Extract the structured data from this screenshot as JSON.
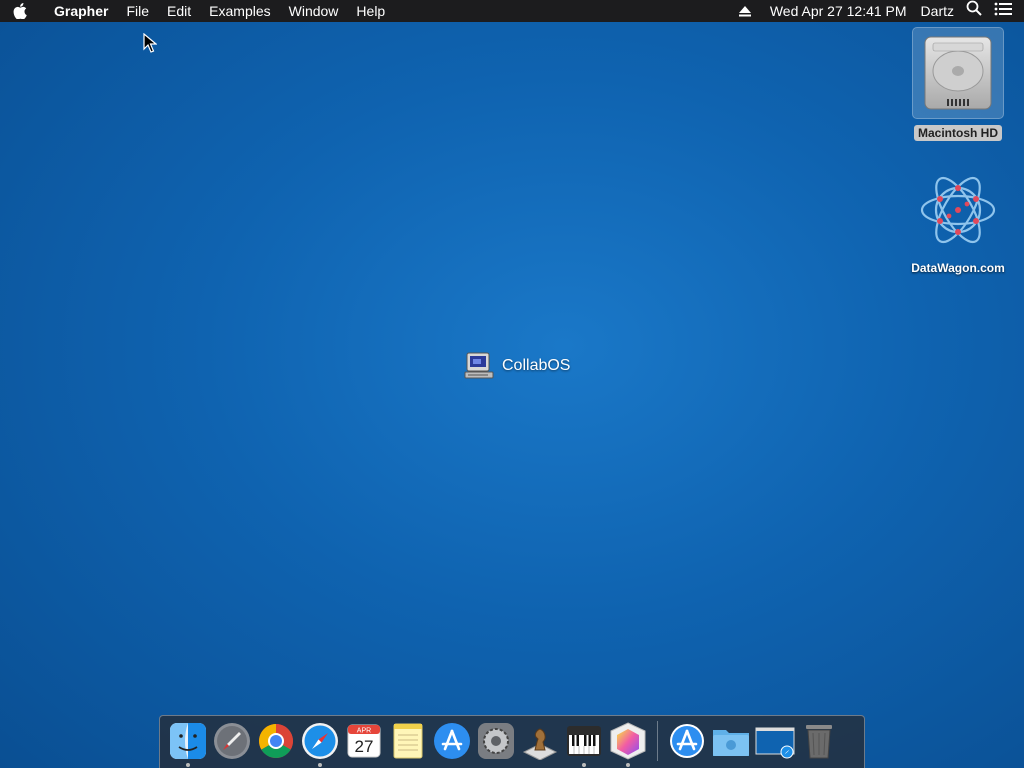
{
  "menubar": {
    "app_name": "Grapher",
    "items": [
      "File",
      "Edit",
      "Examples",
      "Window",
      "Help"
    ],
    "datetime": "Wed Apr 27  12:41 PM",
    "user": "Dartz"
  },
  "desktop": {
    "icons": [
      {
        "label": "Macintosh HD",
        "icon": "hard-drive-icon"
      },
      {
        "label": "DataWagon.com",
        "icon": "datawagon-logo-icon"
      }
    ],
    "center_item": {
      "label": "CollabOS",
      "icon": "computer-icon"
    }
  },
  "dock": {
    "apps": [
      {
        "name": "Finder",
        "icon": "finder-icon",
        "running": true
      },
      {
        "name": "Launchpad",
        "icon": "launchpad-icon",
        "running": false
      },
      {
        "name": "Chrome",
        "icon": "chrome-icon",
        "running": false
      },
      {
        "name": "Safari",
        "icon": "safari-icon",
        "running": true
      },
      {
        "name": "Calendar",
        "icon": "calendar-icon",
        "running": false,
        "month": "APR",
        "day": "27"
      },
      {
        "name": "Notes",
        "icon": "notes-icon",
        "running": false
      },
      {
        "name": "App Store",
        "icon": "app-store-icon",
        "running": false
      },
      {
        "name": "System Preferences",
        "icon": "system-preferences-icon",
        "running": false
      },
      {
        "name": "Chess",
        "icon": "chess-icon",
        "running": false
      },
      {
        "name": "Piano",
        "icon": "piano-icon",
        "running": true
      },
      {
        "name": "Grapher",
        "icon": "grapher-icon",
        "running": true
      }
    ],
    "others": [
      {
        "name": "Applications",
        "icon": "applications-folder-icon"
      },
      {
        "name": "Downloads",
        "icon": "downloads-folder-icon"
      },
      {
        "name": "Safari Window",
        "icon": "minimized-window-icon"
      },
      {
        "name": "Trash",
        "icon": "trash-icon"
      }
    ]
  }
}
